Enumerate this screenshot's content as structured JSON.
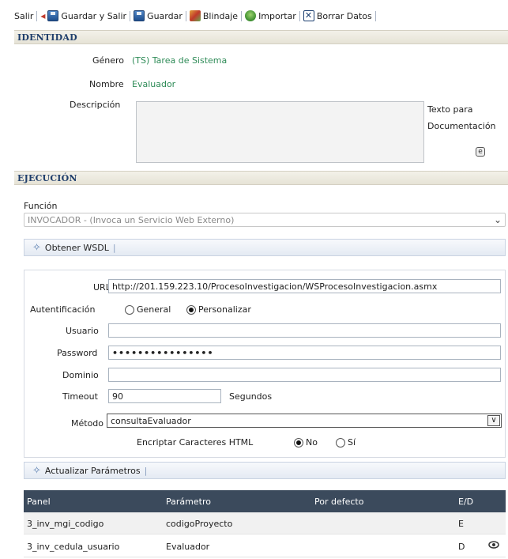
{
  "toolbar": {
    "salir": "Salir",
    "guardar_salir": "Guardar y Salir",
    "guardar": "Guardar",
    "blindaje": "Blindaje",
    "importar": "Importar",
    "borrar": "Borrar Datos"
  },
  "identidad": {
    "title": "IDENTIDAD",
    "genero_label": "Género",
    "genero_value": "(TS) Tarea de Sistema",
    "nombre_label": "Nombre",
    "nombre_value": "Evaluador",
    "descripcion_label": "Descripción",
    "texto_para": "Texto para",
    "documentacion": "Documentación"
  },
  "ejecucion": {
    "title": "EJECUCIÓN",
    "funcion_label": "Función",
    "funcion_value": "INVOCADOR - (Invoca un Servicio Web Externo)",
    "obtener_wsdl": "Obtener WSDL",
    "url_label": "URL",
    "url_value": "http://201.159.223.10/ProcesoInvestigacion/WSProcesoInvestigacion.asmx",
    "autenticacion_label": "Autentificación",
    "auth_general": "General",
    "auth_personalizar": "Personalizar",
    "usuario_label": "Usuario",
    "usuario_value": "",
    "password_label": "Password",
    "password_value": "••••••••••••••••",
    "dominio_label": "Dominio",
    "dominio_value": "",
    "timeout_label": "Timeout",
    "timeout_value": "90",
    "segundos": "Segundos",
    "metodo_label": "Método",
    "metodo_value": "consultaEvaluador",
    "encriptar_label": "Encriptar Caracteres HTML",
    "enc_no": "No",
    "enc_si": "Sí",
    "actualizar_parametros": "Actualizar Parámetros"
  },
  "table": {
    "headers": [
      "Panel",
      "Parámetro",
      "Por defecto",
      "E/D"
    ],
    "rows": [
      {
        "panel": "3_inv_mgi_codigo",
        "parametro": "codigoProyecto",
        "defecto": "",
        "ed": "E"
      },
      {
        "panel": "3_inv_cedula_usuario",
        "parametro": "Evaluador",
        "defecto": "",
        "ed": "D"
      }
    ]
  }
}
